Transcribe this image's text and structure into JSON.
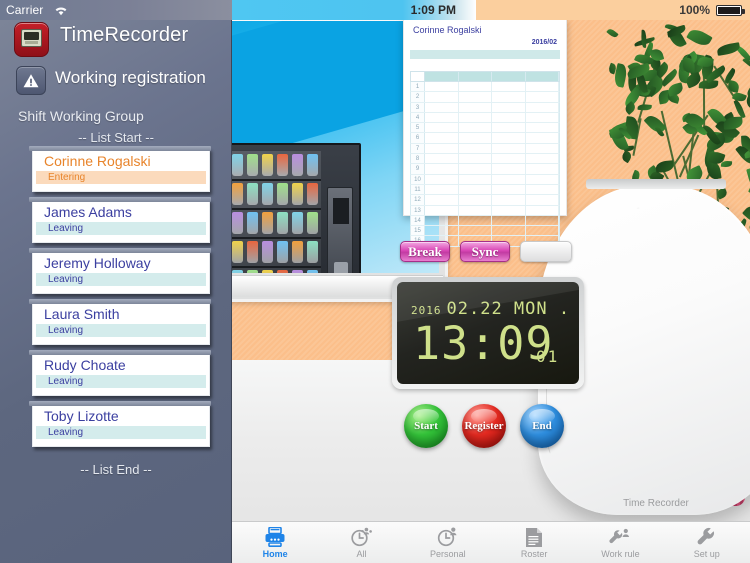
{
  "statusbar": {
    "carrier": "Carrier",
    "wifi_icon": "wifi-icon",
    "time": "1:09 PM",
    "battery_percent": "100%",
    "battery_icon": "battery-full-icon"
  },
  "sidebar": {
    "app_icon": "timerecorder-app-icon",
    "app_title": "TimeRecorder",
    "registration_icon": "warning-triangle-icon",
    "registration_label": "Working registration",
    "group_label": "Shift Working Group",
    "list_start_label": "-- List Start --",
    "list_end_label": "-- List End --",
    "items": [
      {
        "name": "Corinne Rogalski",
        "status": "Entering",
        "state": "entering"
      },
      {
        "name": "James Adams",
        "status": "Leaving",
        "state": "leaving"
      },
      {
        "name": "Jeremy Holloway",
        "status": "Leaving",
        "state": "leaving"
      },
      {
        "name": "Laura Smith",
        "status": "Leaving",
        "state": "leaving"
      },
      {
        "name": "Rudy Choate",
        "status": "Leaving",
        "state": "leaving"
      },
      {
        "name": "Toby Lizotte",
        "status": "Leaving",
        "state": "leaving"
      }
    ],
    "colors": {
      "background": "#5d677f",
      "name_leaving": "#3b3fa0",
      "strip_leaving": "#d4ecec",
      "name_entering": "#e8842b",
      "strip_entering": "#fbdabc"
    }
  },
  "scene": {
    "wall_color": "#fbbf8a",
    "floor_color": "#ececec",
    "window_icon": "window-with-vending-machine",
    "plant_icon": "potted-plant",
    "cup_icon": "coffee-cup",
    "muffin_icon": "muffin"
  },
  "timecard": {
    "employee_name": "Corinne Rogalski",
    "month": "2016/02",
    "row_numbers": [
      "1",
      "2",
      "3",
      "4",
      "5",
      "6",
      "7",
      "8",
      "9",
      "10",
      "11",
      "12",
      "13",
      "14",
      "15",
      "16"
    ],
    "column_count": 4
  },
  "device": {
    "label": "Time Recorder",
    "top_buttons": [
      {
        "label": "Break",
        "icon": "break-button"
      },
      {
        "label": "Sync",
        "icon": "sync-button"
      },
      {
        "label": "",
        "icon": "blank-button"
      }
    ],
    "display": {
      "year": "2016",
      "date": "02.22 MON .",
      "time": "13:09",
      "seconds": "01",
      "screen_color": "#1d1e19",
      "digit_color": "#cfe08a"
    },
    "round_buttons": [
      {
        "label": "Start",
        "color": "#34c43a"
      },
      {
        "label": "Register",
        "color": "#e62a21"
      },
      {
        "label": "End",
        "color": "#2f8fe0"
      }
    ]
  },
  "tabbar": {
    "items": [
      {
        "label": "Home",
        "icon": "printer-home-icon",
        "active": true
      },
      {
        "label": "All",
        "icon": "clock-group-icon",
        "active": false
      },
      {
        "label": "Personal",
        "icon": "clock-person-icon",
        "active": false
      },
      {
        "label": "Roster",
        "icon": "document-icon",
        "active": false
      },
      {
        "label": "Work rule",
        "icon": "wrench-person-icon",
        "active": false
      },
      {
        "label": "Set up",
        "icon": "wrench-icon",
        "active": false
      }
    ],
    "active_color": "#1f84e8",
    "inactive_color": "#9b9c9f"
  }
}
